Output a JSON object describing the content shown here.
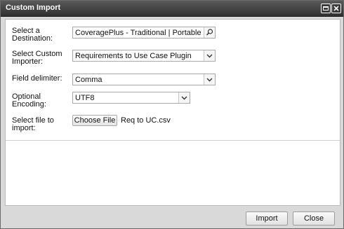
{
  "window": {
    "title": "Custom Import"
  },
  "form": {
    "destination": {
      "label": "Select a Destination:",
      "value": "CoveragePlus - Traditional | Portable Devic"
    },
    "importer": {
      "label": "Select Custom Importer:",
      "value": "Requirements to Use Case Plugin"
    },
    "delimiter": {
      "label": "Field delimiter:",
      "value": "Comma"
    },
    "encoding": {
      "label": "Optional Encoding:",
      "value": "UTF8"
    },
    "file": {
      "label": "Select file to import:",
      "button": "Choose File",
      "filename": "Req to UC.csv"
    }
  },
  "footer": {
    "import_label": "Import",
    "close_label": "Close"
  },
  "icons": {
    "restore": "restore-icon",
    "close": "close-icon",
    "search": "search-icon",
    "dropdown": "chevron-down-icon"
  }
}
